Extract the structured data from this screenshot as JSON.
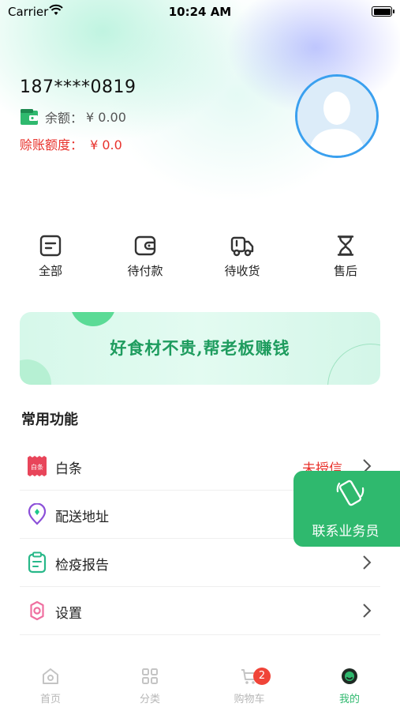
{
  "status_bar": {
    "carrier": "Carrier",
    "time": "10:24 AM"
  },
  "profile": {
    "phone": "187****0819",
    "balance_label": "余额：",
    "balance_value": "¥ 0.00",
    "credit_label": "赊账额度：",
    "credit_value": "¥ 0.0"
  },
  "orders": [
    {
      "label": "全部",
      "icon": "all-orders-icon"
    },
    {
      "label": "待付款",
      "icon": "wallet-icon"
    },
    {
      "label": "待收货",
      "icon": "truck-icon"
    },
    {
      "label": "售后",
      "icon": "hourglass-icon"
    }
  ],
  "banner": {
    "text": "好食材不贵,帮老板赚钱"
  },
  "section": {
    "title": "常用功能"
  },
  "menu": [
    {
      "label": "白条",
      "status": "未授信",
      "icon_text": "白条"
    },
    {
      "label": "配送地址"
    },
    {
      "label": "检疫报告"
    },
    {
      "label": "设置"
    }
  ],
  "float_button": {
    "label": "联系业务员"
  },
  "tabbar": {
    "items": [
      {
        "label": "首页"
      },
      {
        "label": "分类"
      },
      {
        "label": "购物车"
      },
      {
        "label": "我的"
      }
    ],
    "cart_badge": "2"
  },
  "colors": {
    "accent": "#2fb96e",
    "danger": "#e8322c",
    "avatar_ring": "#3aa0ef"
  }
}
